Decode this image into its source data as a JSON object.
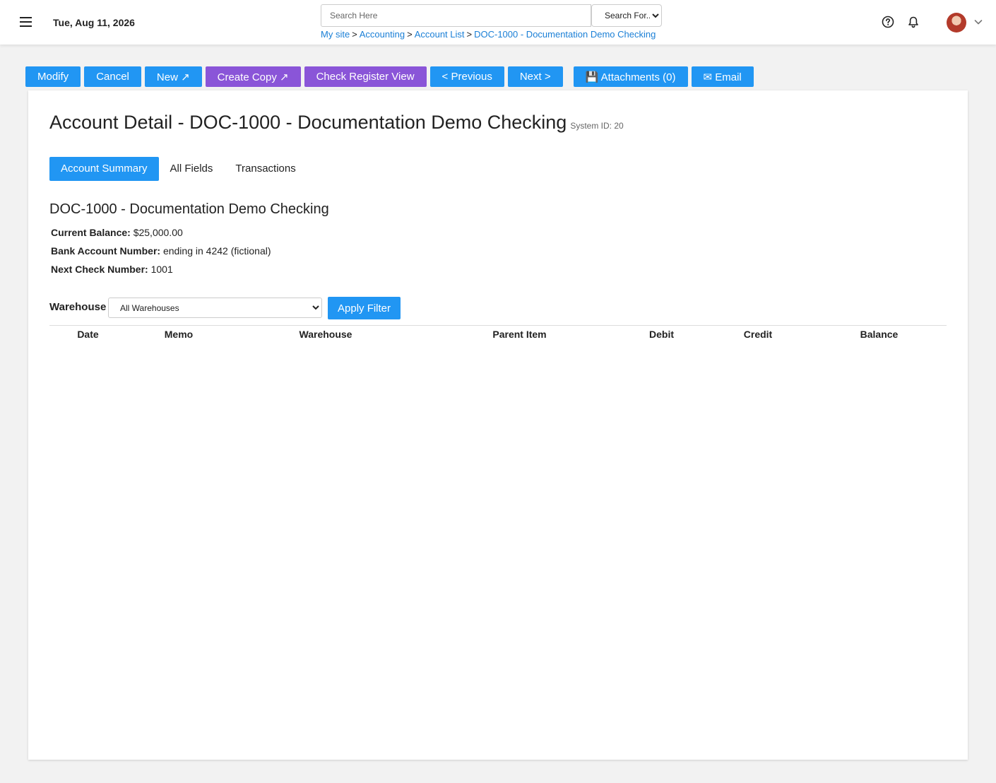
{
  "header": {
    "date": "Tue, Aug 11, 2026",
    "search_placeholder": "Search Here",
    "search_for": "Search For...",
    "breadcrumb": [
      {
        "label": "My site"
      },
      {
        "label": "Accounting"
      },
      {
        "label": "Account List"
      },
      {
        "label": "DOC-1000 - Documentation Demo Checking"
      }
    ],
    "breadcrumb_separator": ">",
    "icons": [
      "menu-icon",
      "help-icon",
      "bell-icon",
      "chevron-down-icon"
    ]
  },
  "actions": {
    "modify": "Modify",
    "cancel": "Cancel",
    "new": "New ↗",
    "create_copy": "Create Copy ↗",
    "check_register_view": "Check Register View",
    "previous": "< Previous",
    "next": "Next >",
    "attachments": "💾 Attachments (0)",
    "email": "✉ Email"
  },
  "colors": {
    "primary": "#2196f3",
    "purple": "#8a55d8",
    "link": "#1a7fd6"
  },
  "page": {
    "title": "Account Detail - DOC-1000 - Documentation Demo Checking",
    "system_id": "System ID: 20"
  },
  "tabs": [
    {
      "label": "Account Summary",
      "active": true
    },
    {
      "label": "All Fields",
      "active": false
    },
    {
      "label": "Transactions",
      "active": false
    }
  ],
  "summary": {
    "title": "DOC-1000 - Documentation Demo Checking",
    "fields": [
      {
        "label": "Current Balance:",
        "value": "$25,000.00"
      },
      {
        "label": "Bank Account Number:",
        "value": "ending in 4242 (fictional)"
      },
      {
        "label": "Next Check Number:",
        "value": "1001"
      }
    ]
  },
  "filter": {
    "label": "Warehouse",
    "selected": "All Warehouses",
    "apply_label": "Apply Filter"
  },
  "table": {
    "columns": [
      "Date",
      "Memo",
      "Warehouse",
      "Parent Item",
      "Debit",
      "Credit",
      "Balance"
    ],
    "rows": []
  }
}
